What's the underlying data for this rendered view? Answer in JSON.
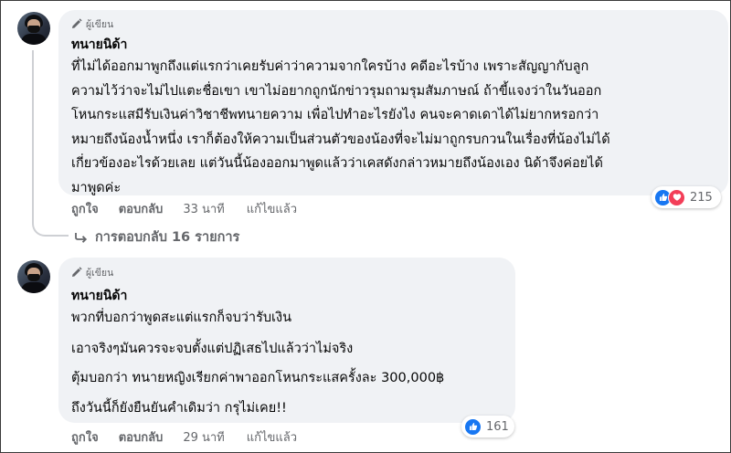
{
  "comments": [
    {
      "author_badge": "ผู้เขียน",
      "author": "ทนายนิด้า",
      "lines": [
        "ที่ไม่ได้ออกมาพูกถึงแต่แรกว่าเคยรับค่าว่าความจากใครบ้าง คดีอะไรบ้าง เพราะสัญญากับลูก",
        "ความไว้ว่าจะไม่ไปแตะชื่อเขา เขาไม่อยากถูกนักข่าวรุมถามรุมสัมภาษณ์ ถ้าขี้แจงว่าในวันออก",
        "โหนกระแสมีรับเงินค่าวิชาชีพทนายความ เพื่อไปทำอะไรยังไง คนจะคาดเดาได้ไม่ยากหรอกว่า",
        "หมายถึงน้องน้ำหนึ่ง เราก็ต้องให้ความเป็นส่วนตัวของน้องที่จะไม่มาถูกรบกวนในเรื่องที่น้องไม่ได้",
        "เกี่ยวข้องอะไรด้วยเลย แต่วันนี้น้องออกมาพูดแล้วว่าเคสดังกล่าวหมายถึงน้องเอง นิด้าจึงค่อยได้",
        "มาพูดค่ะ"
      ],
      "actions": {
        "like": "ถูกใจ",
        "reply": "ตอบกลับ",
        "time": "33 นาที",
        "edited": "แก้ไขแล้ว"
      },
      "reaction_count": "215",
      "reaction_icons": [
        "like-icon",
        "love-icon"
      ]
    },
    {
      "author_badge": "ผู้เขียน",
      "author": "ทนายนิด้า",
      "paragraphs": [
        "พวกที่บอกว่าพูดสะแต่แรกก็จบว่ารับเงิน",
        "เอาจริงๆมันควรจะจบตั้งแต่ปฏิเสธไปแล้วว่าไม่จริง",
        "ตุ้มบอกว่า ทนายหญิงเรียกค่าพาออกโหนกระแสครั้งละ 300,000฿",
        "ถึงวันนี้ก็ยังยืนยันคำเดิมว่า กรุไม่เคย!!"
      ],
      "actions": {
        "like": "ถูกใจ",
        "reply": "ตอบกลับ",
        "time": "29 นาที",
        "edited": "แก้ไขแล้ว"
      },
      "reaction_count": "161",
      "reaction_icons": [
        "like-icon"
      ]
    }
  ],
  "replies_link": "การตอบกลับ 16 รายการ",
  "colors": {
    "bubble": "#f0f2f5",
    "like": "#1877f2",
    "love": "#f33e58",
    "secondary_text": "#65676b"
  }
}
